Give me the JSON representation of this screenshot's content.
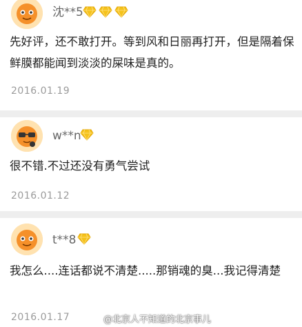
{
  "reviews": [
    {
      "username": "沈**5",
      "badge_icon": "diamond-badge-icon",
      "badge_count": 3,
      "text": "先好评，还不敢打开。等到风和日丽再打开，但是隔着保鲜膜都能闻到淡淡的屎味是真的。",
      "date": "2016.01.19"
    },
    {
      "username": "w**n",
      "badge_icon": "diamond-badge-icon",
      "badge_count": 1,
      "text": "很不错.不过还没有勇气尝试",
      "date": "2016.01.12"
    },
    {
      "username": "t**8",
      "badge_icon": "diamond-badge-icon",
      "badge_count": 1,
      "text": "我怎么....连话都说不清楚.....那销魂的臭...我记得清楚",
      "date": "2016.01.17"
    }
  ],
  "watermark": "@北京人不知道的北京事儿",
  "colors": {
    "badge_gold": "#f5c21b",
    "text": "#222222",
    "muted": "#9a9a9a",
    "username": "#666666"
  }
}
